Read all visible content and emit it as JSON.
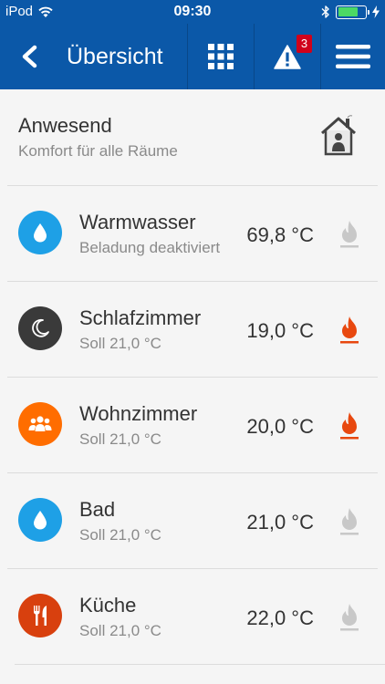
{
  "status": {
    "carrier": "iPod",
    "time": "09:30",
    "battery_level": 0.75
  },
  "nav": {
    "title": "Übersicht",
    "alert_count": "3",
    "icons": [
      "back-chevron-icon",
      "grid-icon",
      "warning-icon",
      "menu-icon"
    ]
  },
  "presence": {
    "title": "Anwesend",
    "subtitle": "Komfort für alle Räume",
    "icon": "house-icon"
  },
  "colors": {
    "header": "#0b58a8",
    "water": "#1ea0e6",
    "night": "#3a3a3a",
    "living": "#ff6d00",
    "kitchen": "#d8400e",
    "flame_active": "#e8480f",
    "flame_inactive": "#c8c8c8"
  },
  "rooms": [
    {
      "name": "Warmwasser",
      "sub": "Beladung deaktiviert",
      "temp": "69,8 °C",
      "icon": "water-drop-icon",
      "heating": false
    },
    {
      "name": "Schlafzimmer",
      "sub": "Soll 21,0 °C",
      "temp": "19,0 °C",
      "icon": "moon-icon",
      "heating": true
    },
    {
      "name": "Wohnzimmer",
      "sub": "Soll 21,0 °C",
      "temp": "20,0 °C",
      "icon": "people-icon",
      "heating": true
    },
    {
      "name": "Bad",
      "sub": "Soll 21,0 °C",
      "temp": "21,0 °C",
      "icon": "water-drop-icon",
      "heating": false
    },
    {
      "name": "Küche",
      "sub": "Soll 21,0 °C",
      "temp": "22,0 °C",
      "icon": "cutlery-icon",
      "heating": false
    }
  ]
}
